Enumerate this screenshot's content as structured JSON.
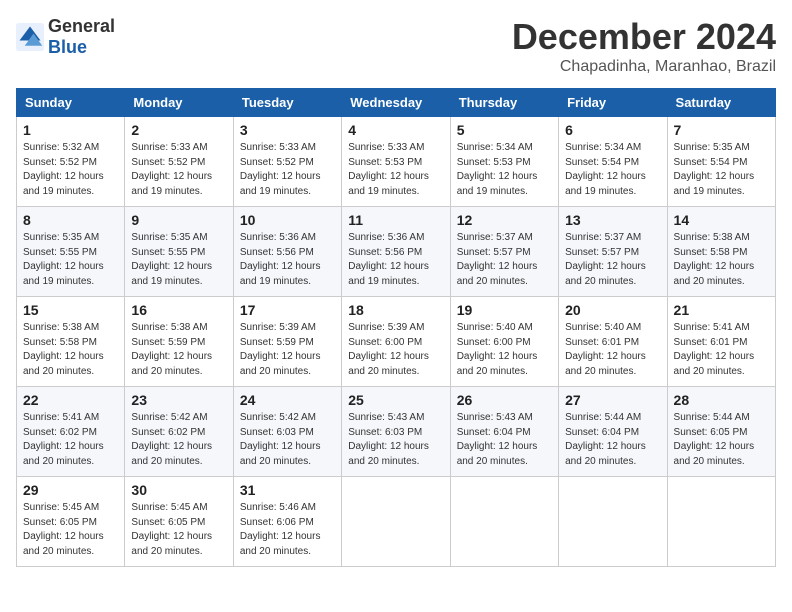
{
  "logo": {
    "general": "General",
    "blue": "Blue"
  },
  "title": {
    "month": "December 2024",
    "location": "Chapadinha, Maranhao, Brazil"
  },
  "headers": [
    "Sunday",
    "Monday",
    "Tuesday",
    "Wednesday",
    "Thursday",
    "Friday",
    "Saturday"
  ],
  "weeks": [
    [
      {
        "day": "1",
        "info": "Sunrise: 5:32 AM\nSunset: 5:52 PM\nDaylight: 12 hours\nand 19 minutes."
      },
      {
        "day": "2",
        "info": "Sunrise: 5:33 AM\nSunset: 5:52 PM\nDaylight: 12 hours\nand 19 minutes."
      },
      {
        "day": "3",
        "info": "Sunrise: 5:33 AM\nSunset: 5:52 PM\nDaylight: 12 hours\nand 19 minutes."
      },
      {
        "day": "4",
        "info": "Sunrise: 5:33 AM\nSunset: 5:53 PM\nDaylight: 12 hours\nand 19 minutes."
      },
      {
        "day": "5",
        "info": "Sunrise: 5:34 AM\nSunset: 5:53 PM\nDaylight: 12 hours\nand 19 minutes."
      },
      {
        "day": "6",
        "info": "Sunrise: 5:34 AM\nSunset: 5:54 PM\nDaylight: 12 hours\nand 19 minutes."
      },
      {
        "day": "7",
        "info": "Sunrise: 5:35 AM\nSunset: 5:54 PM\nDaylight: 12 hours\nand 19 minutes."
      }
    ],
    [
      {
        "day": "8",
        "info": "Sunrise: 5:35 AM\nSunset: 5:55 PM\nDaylight: 12 hours\nand 19 minutes."
      },
      {
        "day": "9",
        "info": "Sunrise: 5:35 AM\nSunset: 5:55 PM\nDaylight: 12 hours\nand 19 minutes."
      },
      {
        "day": "10",
        "info": "Sunrise: 5:36 AM\nSunset: 5:56 PM\nDaylight: 12 hours\nand 19 minutes."
      },
      {
        "day": "11",
        "info": "Sunrise: 5:36 AM\nSunset: 5:56 PM\nDaylight: 12 hours\nand 19 minutes."
      },
      {
        "day": "12",
        "info": "Sunrise: 5:37 AM\nSunset: 5:57 PM\nDaylight: 12 hours\nand 20 minutes."
      },
      {
        "day": "13",
        "info": "Sunrise: 5:37 AM\nSunset: 5:57 PM\nDaylight: 12 hours\nand 20 minutes."
      },
      {
        "day": "14",
        "info": "Sunrise: 5:38 AM\nSunset: 5:58 PM\nDaylight: 12 hours\nand 20 minutes."
      }
    ],
    [
      {
        "day": "15",
        "info": "Sunrise: 5:38 AM\nSunset: 5:58 PM\nDaylight: 12 hours\nand 20 minutes."
      },
      {
        "day": "16",
        "info": "Sunrise: 5:38 AM\nSunset: 5:59 PM\nDaylight: 12 hours\nand 20 minutes."
      },
      {
        "day": "17",
        "info": "Sunrise: 5:39 AM\nSunset: 5:59 PM\nDaylight: 12 hours\nand 20 minutes."
      },
      {
        "day": "18",
        "info": "Sunrise: 5:39 AM\nSunset: 6:00 PM\nDaylight: 12 hours\nand 20 minutes."
      },
      {
        "day": "19",
        "info": "Sunrise: 5:40 AM\nSunset: 6:00 PM\nDaylight: 12 hours\nand 20 minutes."
      },
      {
        "day": "20",
        "info": "Sunrise: 5:40 AM\nSunset: 6:01 PM\nDaylight: 12 hours\nand 20 minutes."
      },
      {
        "day": "21",
        "info": "Sunrise: 5:41 AM\nSunset: 6:01 PM\nDaylight: 12 hours\nand 20 minutes."
      }
    ],
    [
      {
        "day": "22",
        "info": "Sunrise: 5:41 AM\nSunset: 6:02 PM\nDaylight: 12 hours\nand 20 minutes."
      },
      {
        "day": "23",
        "info": "Sunrise: 5:42 AM\nSunset: 6:02 PM\nDaylight: 12 hours\nand 20 minutes."
      },
      {
        "day": "24",
        "info": "Sunrise: 5:42 AM\nSunset: 6:03 PM\nDaylight: 12 hours\nand 20 minutes."
      },
      {
        "day": "25",
        "info": "Sunrise: 5:43 AM\nSunset: 6:03 PM\nDaylight: 12 hours\nand 20 minutes."
      },
      {
        "day": "26",
        "info": "Sunrise: 5:43 AM\nSunset: 6:04 PM\nDaylight: 12 hours\nand 20 minutes."
      },
      {
        "day": "27",
        "info": "Sunrise: 5:44 AM\nSunset: 6:04 PM\nDaylight: 12 hours\nand 20 minutes."
      },
      {
        "day": "28",
        "info": "Sunrise: 5:44 AM\nSunset: 6:05 PM\nDaylight: 12 hours\nand 20 minutes."
      }
    ],
    [
      {
        "day": "29",
        "info": "Sunrise: 5:45 AM\nSunset: 6:05 PM\nDaylight: 12 hours\nand 20 minutes."
      },
      {
        "day": "30",
        "info": "Sunrise: 5:45 AM\nSunset: 6:05 PM\nDaylight: 12 hours\nand 20 minutes."
      },
      {
        "day": "31",
        "info": "Sunrise: 5:46 AM\nSunset: 6:06 PM\nDaylight: 12 hours\nand 20 minutes."
      },
      null,
      null,
      null,
      null
    ]
  ]
}
